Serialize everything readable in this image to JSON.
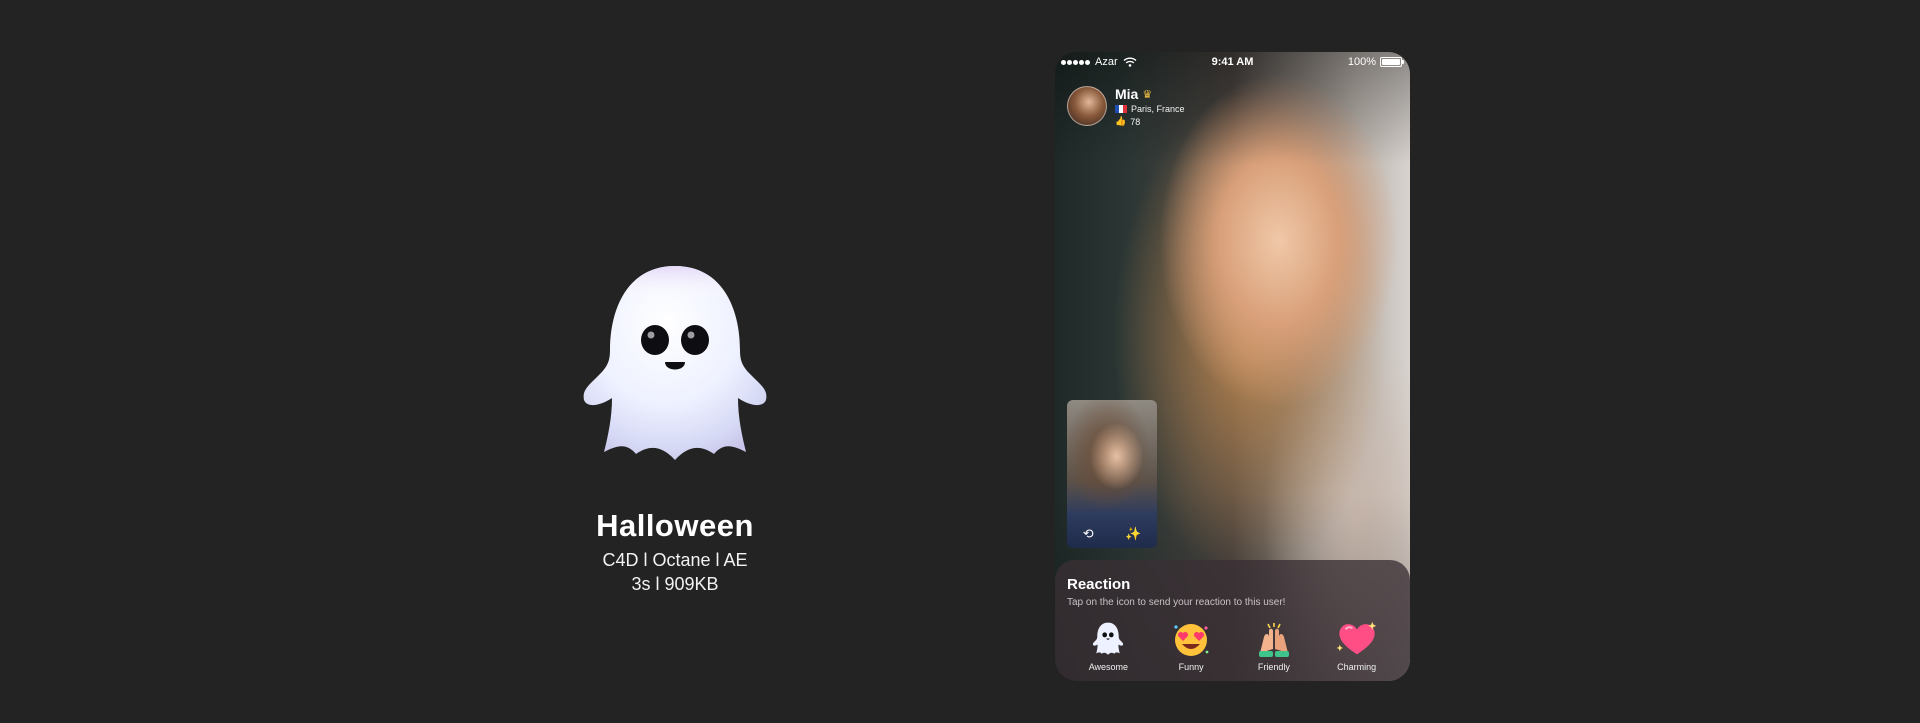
{
  "hero": {
    "title": "Halloween",
    "tools": "C4D l Octane l AE",
    "specs": "3s l 909KB"
  },
  "status_bar": {
    "carrier": "Azar",
    "time": "9:41 AM",
    "battery": "100%"
  },
  "profile": {
    "name": "Mia",
    "location": "Paris, France",
    "likes": "78"
  },
  "reaction": {
    "title": "Reaction",
    "subtitle": "Tap on the icon to send your reaction to this user!",
    "items": [
      {
        "label": "Awesome",
        "icon": "ghost-icon"
      },
      {
        "label": "Funny",
        "icon": "heart-eyes-icon"
      },
      {
        "label": "Friendly",
        "icon": "high-five-icon"
      },
      {
        "label": "Charming",
        "icon": "heart-icon"
      }
    ]
  },
  "colors": {
    "background": "#232323",
    "sheet": "#3a3034",
    "crown": "#f6c443",
    "heart": "#ff4d86"
  }
}
